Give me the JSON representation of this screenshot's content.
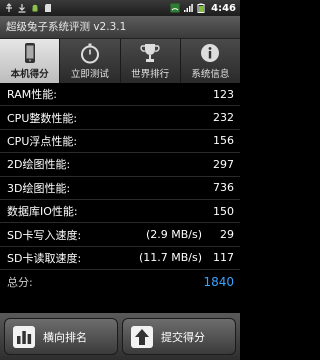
{
  "status": {
    "time": "4:46",
    "icons": [
      "usb-icon",
      "download-icon",
      "android-icon",
      "sd-card-icon",
      "wifi-icon",
      "signal-icon",
      "battery-icon"
    ]
  },
  "titlebar": {
    "title": "超级兔子系统评测 v2.3.1"
  },
  "tabs": [
    {
      "label": "本机得分",
      "icon": "phone-icon",
      "active": true
    },
    {
      "label": "立即测试",
      "icon": "stopwatch-icon",
      "active": false
    },
    {
      "label": "世界排行",
      "icon": "trophy-icon",
      "active": false
    },
    {
      "label": "系统信息",
      "icon": "info-icon",
      "active": false
    }
  ],
  "scores": {
    "ram": {
      "label": "RAM性能:",
      "value": "123"
    },
    "cpu_int": {
      "label": "CPU整数性能:",
      "value": "232"
    },
    "cpu_float": {
      "label": "CPU浮点性能:",
      "value": "156"
    },
    "gfx2d": {
      "label": "2D绘图性能:",
      "value": "297"
    },
    "gfx3d": {
      "label": "3D绘图性能:",
      "value": "736"
    },
    "db_io": {
      "label": "数据库IO性能:",
      "value": "150"
    },
    "sd_write": {
      "label": "SD卡写入速度:",
      "speed": "(2.9 MB/s)",
      "value": "29"
    },
    "sd_read": {
      "label": "SD卡读取速度:",
      "speed": "(11.7 MB/s)",
      "value": "117"
    },
    "total": {
      "label": "总分:",
      "value": "1840"
    }
  },
  "buttons": {
    "ranking": {
      "label": "横向排名",
      "icon": "bar-chart-icon"
    },
    "submit": {
      "label": "提交得分",
      "icon": "up-arrow-icon"
    }
  },
  "colors": {
    "total_value": "#36a3ff",
    "active_tab": "#d8d8d8"
  }
}
